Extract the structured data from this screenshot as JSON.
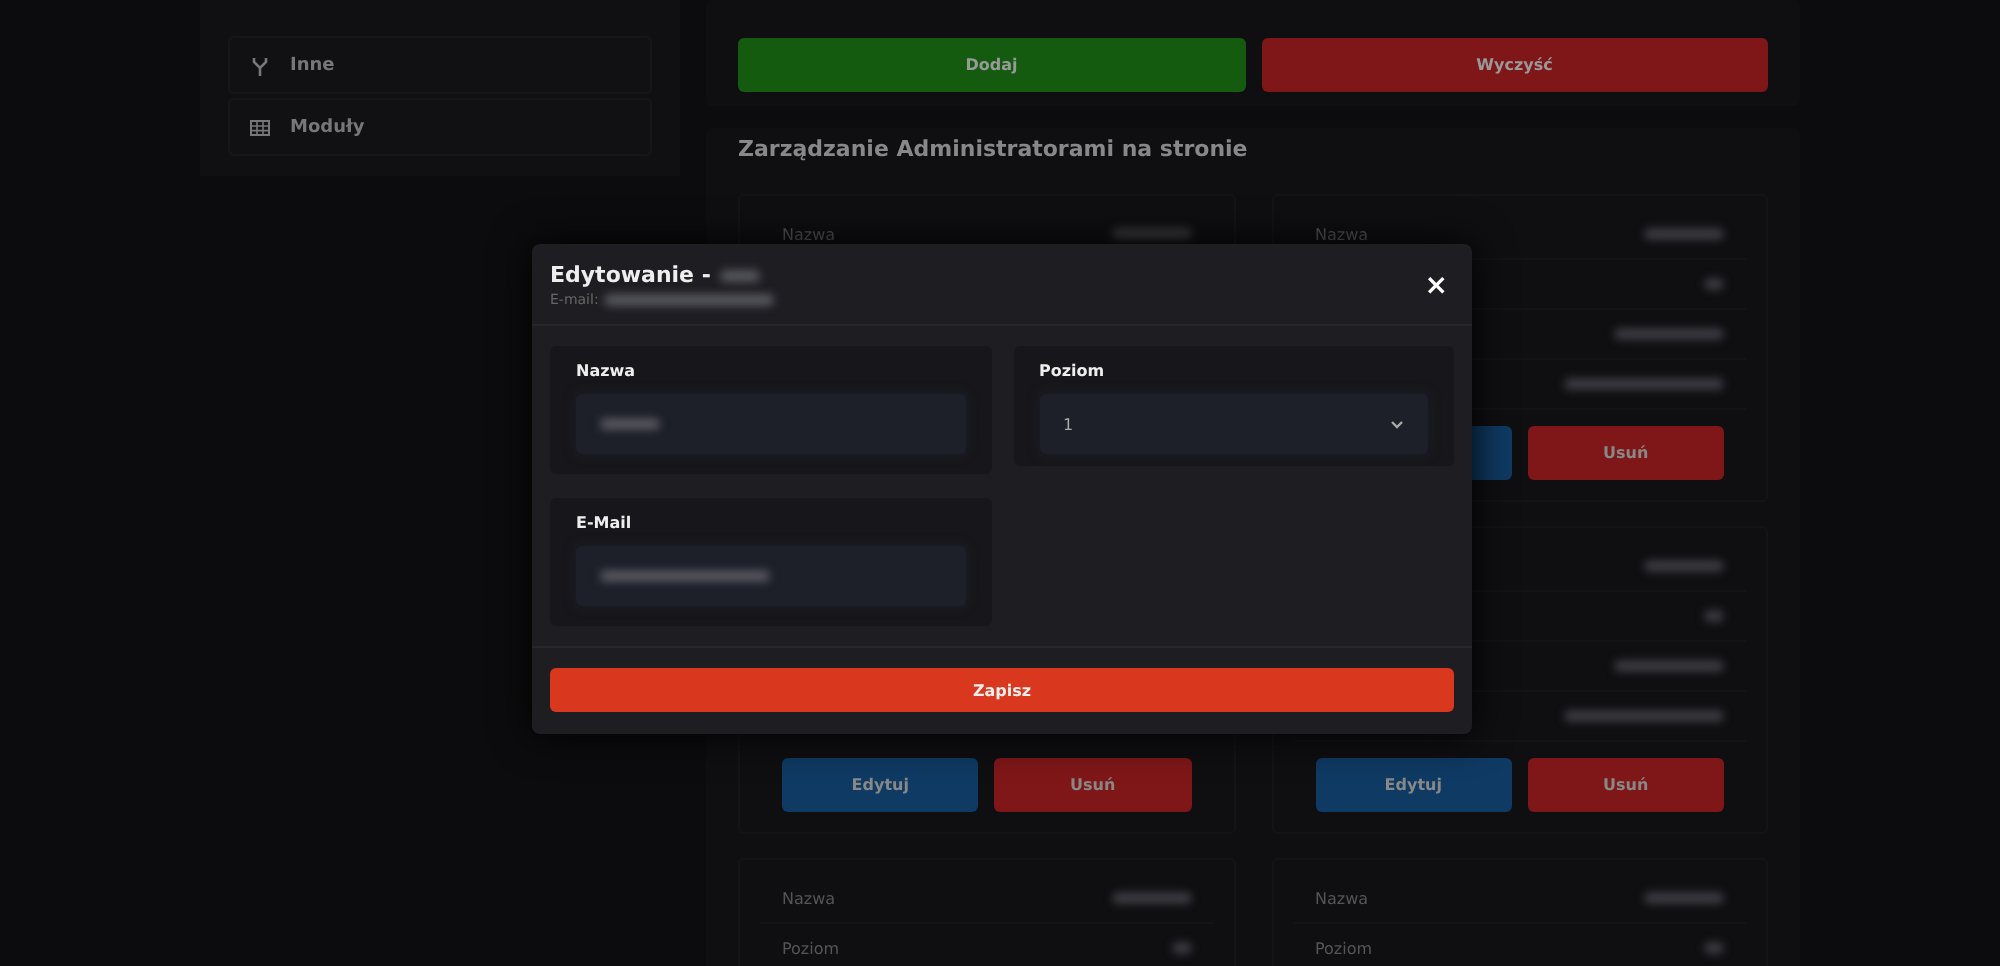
{
  "sidebar": {
    "items": [
      {
        "label": "Inne"
      },
      {
        "label": "Moduły"
      }
    ]
  },
  "actions": [
    {
      "label": "Dodaj",
      "kind": "add"
    },
    {
      "label": "Wyczyść",
      "kind": "clear"
    }
  ],
  "admins": {
    "title": "Zarządzanie Administratorami na stronie",
    "cards": [
      {
        "rows": [
          {
            "label": "Nazwa"
          }
        ]
      },
      {
        "rows": [
          {
            "label": "Nazwa"
          },
          {},
          {},
          {}
        ],
        "buttons": [
          {
            "kind": "edit"
          },
          {
            "kind": "delete",
            "label": "Usuń"
          }
        ]
      },
      {
        "buttons": [
          {
            "kind": "edit",
            "label": "Edytuj"
          },
          {
            "kind": "delete",
            "label": "Usuń"
          }
        ]
      },
      {
        "rows": [
          {},
          {},
          {},
          {}
        ],
        "buttons": [
          {
            "kind": "edit",
            "label": "Edytuj"
          },
          {
            "kind": "delete",
            "label": "Usuń"
          }
        ]
      },
      {
        "rows": [
          {
            "label": "Nazwa"
          },
          {
            "label": "Poziom"
          }
        ]
      },
      {
        "rows": [
          {
            "label": "Nazwa"
          },
          {
            "label": "Poziom"
          }
        ]
      }
    ]
  },
  "modal": {
    "title": "Edytowanie -",
    "subtitle": "E-mail:",
    "close": "×",
    "fields": [
      {
        "label": "Nazwa",
        "kind": "text"
      },
      {
        "label": "Poziom",
        "kind": "select",
        "value": "1"
      },
      {
        "label": "E-Mail",
        "kind": "text"
      }
    ],
    "submit": "Zapisz"
  }
}
